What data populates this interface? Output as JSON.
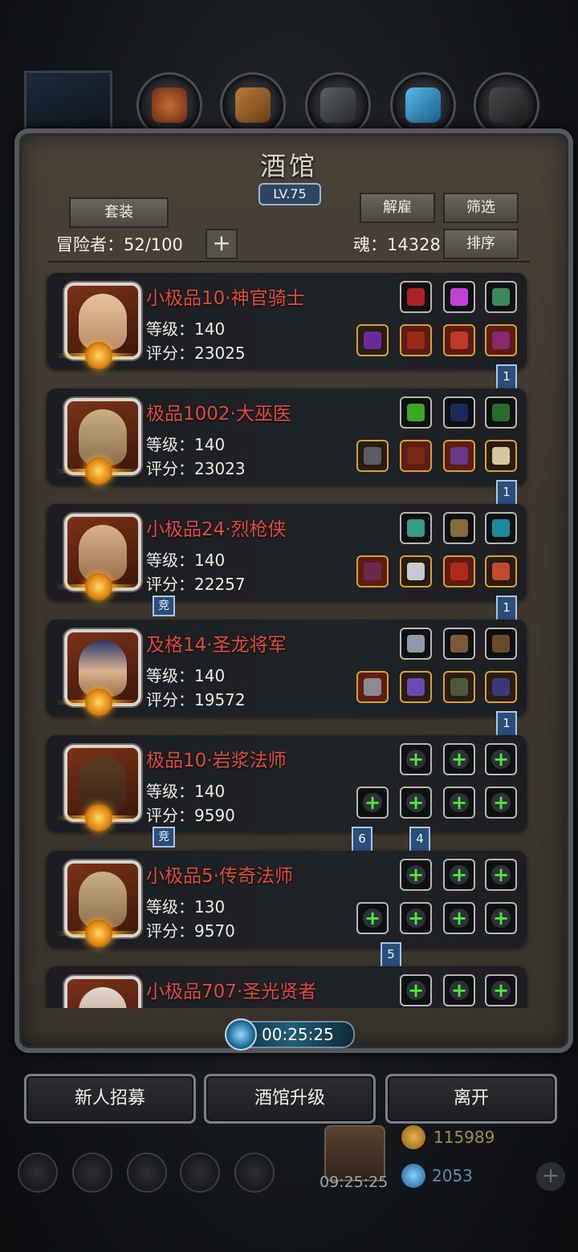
{
  "top_icons": [
    "portrait",
    "meat-icon",
    "wood-icon",
    "iron-icon",
    "crystal-icon",
    "anvil-icon"
  ],
  "tavern": {
    "title": "酒馆",
    "level": "LV.75",
    "suit_button": "套装",
    "dismiss_button": "解雇",
    "filter_button": "筛选",
    "sort_button": "排序",
    "adventurers_label": "冒险者：52/100",
    "soul_label": "魂：14328"
  },
  "heroes": [
    {
      "name": "小极品10·神官骑士",
      "level": "等级：140",
      "score": "评分：23025",
      "ribbon": "1"
    },
    {
      "name": "极品1002·大巫医",
      "level": "等级：140",
      "score": "评分：23023",
      "ribbon": "1"
    },
    {
      "name": "小极品24·烈枪侠",
      "level": "等级：140",
      "score": "评分：22257",
      "ribbon": "1",
      "tag": "竞"
    },
    {
      "name": "及格14·圣龙将军",
      "level": "等级：140",
      "score": "评分：19572",
      "ribbon": "1"
    },
    {
      "name": "极品10·岩浆法师",
      "level": "等级：140",
      "score": "评分：9590",
      "tag": "竞",
      "ribbon_a": "6",
      "ribbon_b": "4"
    },
    {
      "name": "小极品5·传奇法师",
      "level": "等级：130",
      "score": "评分：9570",
      "ribbon": "5"
    },
    {
      "name": "小极品707·圣光贤者"
    }
  ],
  "timer": "00:25:25",
  "actions": {
    "recruit": "新人招募",
    "upgrade": "酒馆升级",
    "leave": "离开"
  },
  "resources": {
    "gold": "115989",
    "gem": "2053",
    "clock": "09:25:25"
  },
  "colors": {
    "hero_name": "#e04a3c",
    "empty_slot_plus": "#4ee83c",
    "ribbon": "#2a4e7a"
  }
}
